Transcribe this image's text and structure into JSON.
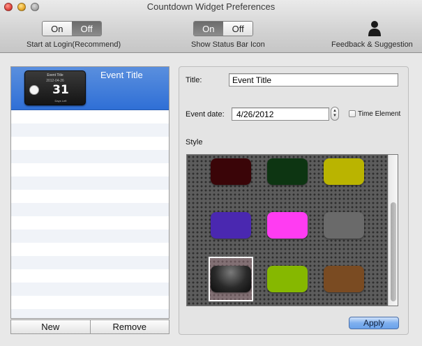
{
  "window": {
    "title": "Countdown Widget Preferences"
  },
  "toolbar": {
    "login": {
      "on_label": "On",
      "off_label": "Off",
      "selected": "Off",
      "caption": "Start at Login(Recommend)"
    },
    "status_bar": {
      "on_label": "On",
      "off_label": "Off",
      "selected": "On",
      "caption": "Show Status Bar Icon"
    },
    "feedback": {
      "caption": "Feedback & Suggestion",
      "icon": "person-silhouette-icon"
    }
  },
  "events": {
    "items": [
      {
        "title": "Event Title",
        "thumbnail": {
          "title": "Event Title",
          "date": "2012-04-26",
          "count": "31",
          "caption": "Days Left",
          "icon": "alarm-clock-icon"
        }
      }
    ],
    "new_label": "New",
    "remove_label": "Remove"
  },
  "form": {
    "title_label": "Title:",
    "title_value": "Event Title",
    "date_label": "Event date:",
    "date_value": "4/26/2012",
    "time_element_label": "Time Element",
    "time_element_checked": false,
    "style_label": "Style",
    "apply_label": "Apply"
  },
  "styles": {
    "swatches": [
      {
        "name": "dark-red",
        "color": "#3a0508"
      },
      {
        "name": "dark-green",
        "color": "#0d3512"
      },
      {
        "name": "olive-yellow",
        "color": "#bab400"
      },
      {
        "name": "purple",
        "color": "#4a28b0"
      },
      {
        "name": "magenta",
        "color": "#ff3cf2"
      },
      {
        "name": "gray",
        "color": "#6a6a6a"
      },
      {
        "name": "black-gloss",
        "color": "#1a1a1a",
        "selected": true
      },
      {
        "name": "lime",
        "color": "#86b800"
      },
      {
        "name": "brown",
        "color": "#7a4b22"
      }
    ]
  },
  "colors": {
    "selection_blue": "#2f6fd6",
    "apply_blue": "#7fb0ef"
  }
}
